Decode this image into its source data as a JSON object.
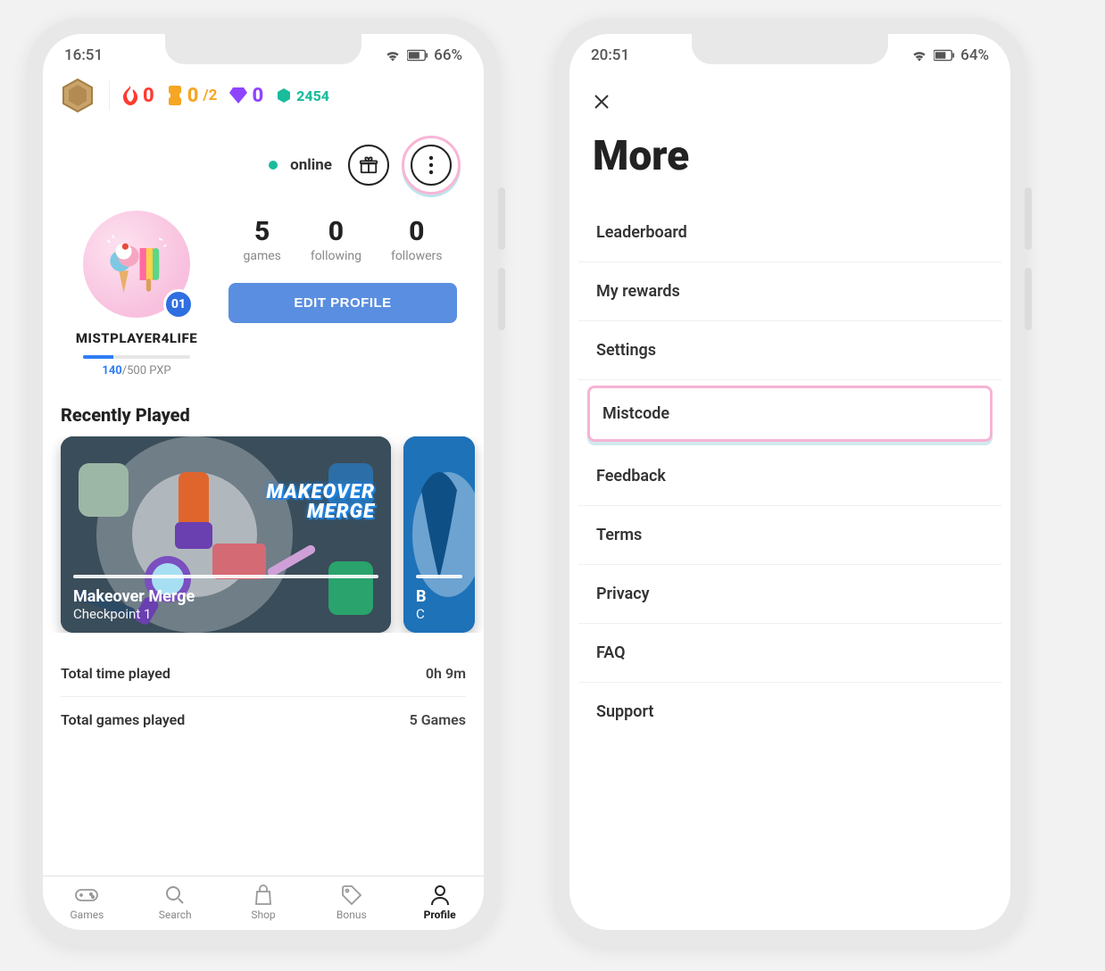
{
  "phone1": {
    "status": {
      "time": "16:51",
      "battery": "66%"
    },
    "currency": {
      "fire": "0",
      "tickets_cur": "0",
      "tickets_max": "/2",
      "gems": "0",
      "coins": "2454"
    },
    "online_label": "online",
    "avatar_level": "01",
    "username": "MISTPLAYER4LIFE",
    "pxp_current": "140",
    "pxp_rest": "/500 PXP",
    "stats": {
      "games": {
        "num": "5",
        "label": "games"
      },
      "following": {
        "num": "0",
        "label": "following"
      },
      "followers": {
        "num": "0",
        "label": "followers"
      }
    },
    "edit_profile": "EDIT PROFILE",
    "recently_played_title": "Recently Played",
    "game_card": {
      "logo_line1": "MAKEOVER",
      "logo_line2": "MERGE",
      "title": "Makeover Merge",
      "subtitle": "Checkpoint 1"
    },
    "game_card2": {
      "title_initial": "B",
      "subtitle_initial": "C"
    },
    "totals": {
      "time_label": "Total time played",
      "time_value": "0h 9m",
      "games_label": "Total games played",
      "games_value": "5 Games"
    },
    "tabs": {
      "games": "Games",
      "search": "Search",
      "shop": "Shop",
      "bonus": "Bonus",
      "profile": "Profile"
    }
  },
  "phone2": {
    "status": {
      "time": "20:51",
      "battery": "64%"
    },
    "title": "More",
    "items": [
      "Leaderboard",
      "My rewards",
      "Settings",
      "Mistcode",
      "Feedback",
      "Terms",
      "Privacy",
      "FAQ",
      "Support"
    ],
    "highlight_index": 3
  }
}
